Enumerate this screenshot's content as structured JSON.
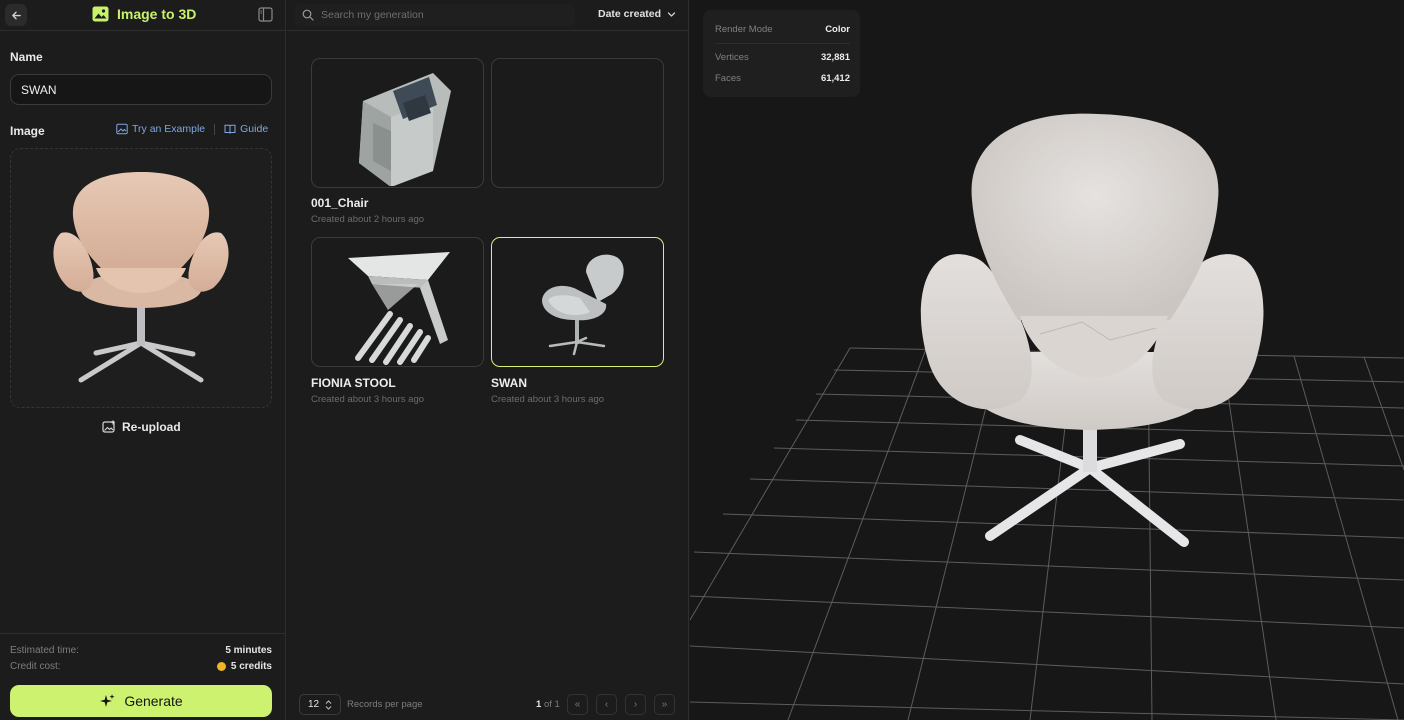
{
  "left_panel": {
    "title": "Image to 3D",
    "name_label": "Name",
    "name_value": "SWAN",
    "image_label": "Image",
    "try_example": "Try an Example",
    "guide": "Guide",
    "reupload": "Re-upload",
    "estimated_time_label": "Estimated time:",
    "estimated_time_value": "5 minutes",
    "credit_cost_label": "Credit cost:",
    "credit_cost_value": "5 credits",
    "generate": "Generate",
    "accent_color": "#cdf26f"
  },
  "gallery": {
    "search_placeholder": "Search my generation",
    "sort_label": "Date created",
    "items": [
      {
        "title": "001_Chair",
        "subtitle": "Created about 2 hours ago",
        "thumb": "armchair"
      },
      {
        "title": "",
        "subtitle": "",
        "thumb": "empty"
      },
      {
        "title": "FIONIA STOOL",
        "subtitle": "Created about 3 hours ago",
        "thumb": "stool"
      },
      {
        "title": "SWAN",
        "subtitle": "Created about 3 hours ago",
        "thumb": "swan",
        "selected": true
      }
    ],
    "per_page": "12",
    "per_page_label": "Records per page",
    "page_current": "1",
    "page_of": "of 1"
  },
  "viewer": {
    "render_mode_label": "Render Mode",
    "render_mode_value": "Color",
    "vertices_label": "Vertices",
    "vertices_value": "32,881",
    "faces_label": "Faces",
    "faces_value": "61,412"
  }
}
